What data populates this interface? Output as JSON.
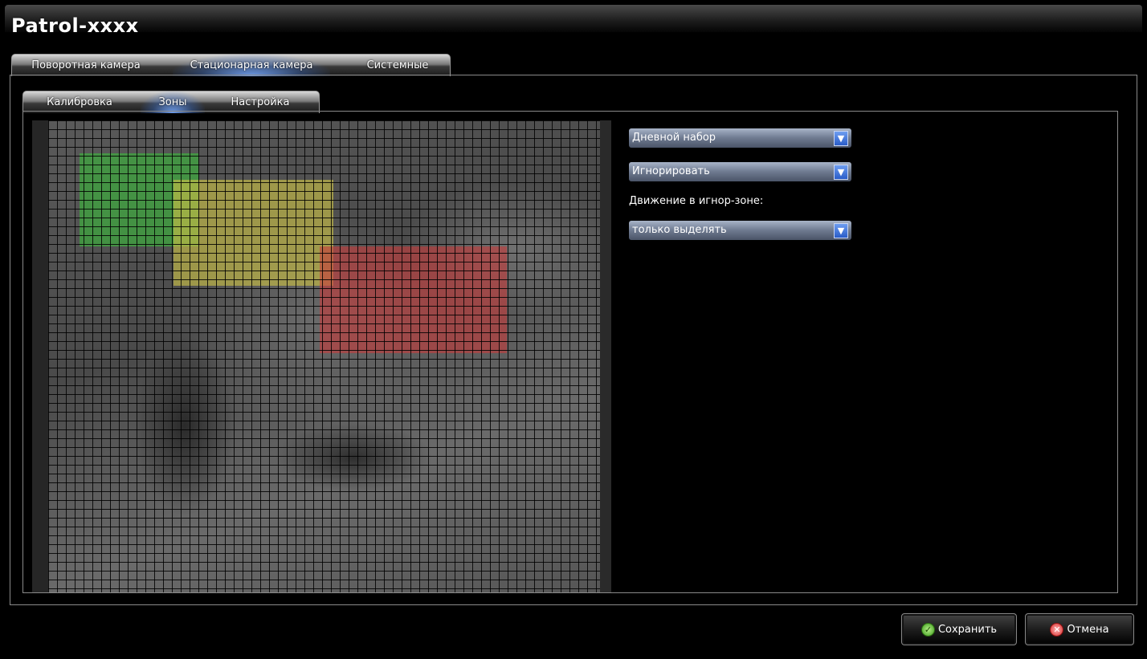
{
  "window": {
    "title": "Patrol-xxxx"
  },
  "tabs_top": [
    {
      "label": "Поворотная камера",
      "active": false
    },
    {
      "label": "Стационарная камера",
      "active": true
    },
    {
      "label": "Системные",
      "active": false
    }
  ],
  "tabs_second": [
    {
      "label": "Калибровка",
      "active": false
    },
    {
      "label": "Зоны",
      "active": true
    },
    {
      "label": "Настройка",
      "active": false
    }
  ],
  "zones_panel": {
    "zones": [
      {
        "name": "green-zone",
        "color": "#3cb43c"
      },
      {
        "name": "yellow-zone",
        "color": "#c8be46"
      },
      {
        "name": "red-zone",
        "color": "#c83c3c"
      }
    ]
  },
  "settings": {
    "preset_dropdown": "Дневной набор",
    "zone_type_dropdown": "Игнорировать",
    "ignore_motion_label": "Движение в игнор-зоне:",
    "ignore_motion_dropdown": "только выделять",
    "dropdown_arrow": "▼"
  },
  "footer": {
    "save_label": "Сохранить",
    "cancel_label": "Отмена",
    "save_icon": "check-circle-icon",
    "cancel_icon": "x-circle-icon",
    "save_glyph": "✓",
    "cancel_glyph": "✕"
  }
}
